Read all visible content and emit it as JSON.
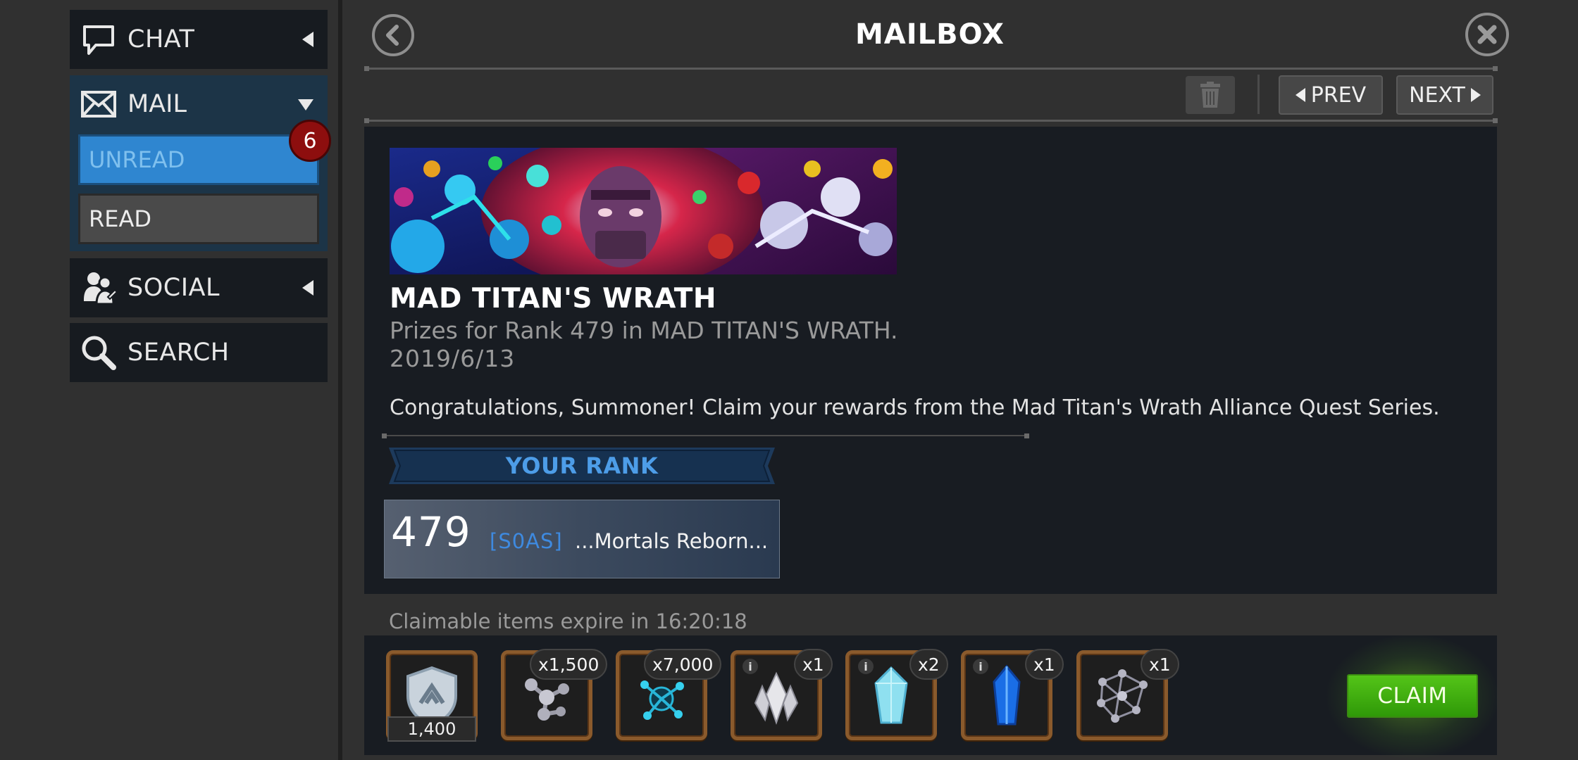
{
  "sidebar": {
    "chat_label": "CHAT",
    "mail_label": "MAIL",
    "unread_label": "UNREAD",
    "unread_count": "6",
    "read_label": "READ",
    "social_label": "SOCIAL",
    "search_label": "SEARCH"
  },
  "header": {
    "title": "MAILBOX"
  },
  "toolbar": {
    "prev_label": "PREV",
    "next_label": "NEXT"
  },
  "message": {
    "title": "MAD TITAN'S WRATH",
    "subtitle": "Prizes for Rank 479 in MAD TITAN'S WRATH.",
    "date": "2019/6/13",
    "body": "Congratulations, Summoner! Claim your rewards from the Mad Titan's Wrath Alliance Quest Series.",
    "rank_heading": "YOUR RANK",
    "rank_number": "479",
    "alliance_tag": "[S0AS]",
    "alliance_name": "...Mortals Reborn..."
  },
  "rewards": {
    "expire_text": "Claimable items expire in 16:20:18",
    "items": [
      {
        "icon": "shield-emblem-icon",
        "quantity": "1,400"
      },
      {
        "icon": "catalyst-molecule-icon",
        "quantity": "x1,500"
      },
      {
        "icon": "blue-catalyst-icon",
        "quantity": "x7,000"
      },
      {
        "icon": "silver-crystal-icon",
        "quantity": "x1"
      },
      {
        "icon": "light-blue-crystal-icon",
        "quantity": "x2"
      },
      {
        "icon": "blue-crystal-icon",
        "quantity": "x1"
      },
      {
        "icon": "molecule-network-icon",
        "quantity": "x1"
      }
    ],
    "claim_label": "CLAIM"
  },
  "colors": {
    "accent_blue": "#2f86d0",
    "claim_green": "#4cba14",
    "badge_red": "#8d0e0e",
    "reward_frame": "#8a5a2c"
  }
}
